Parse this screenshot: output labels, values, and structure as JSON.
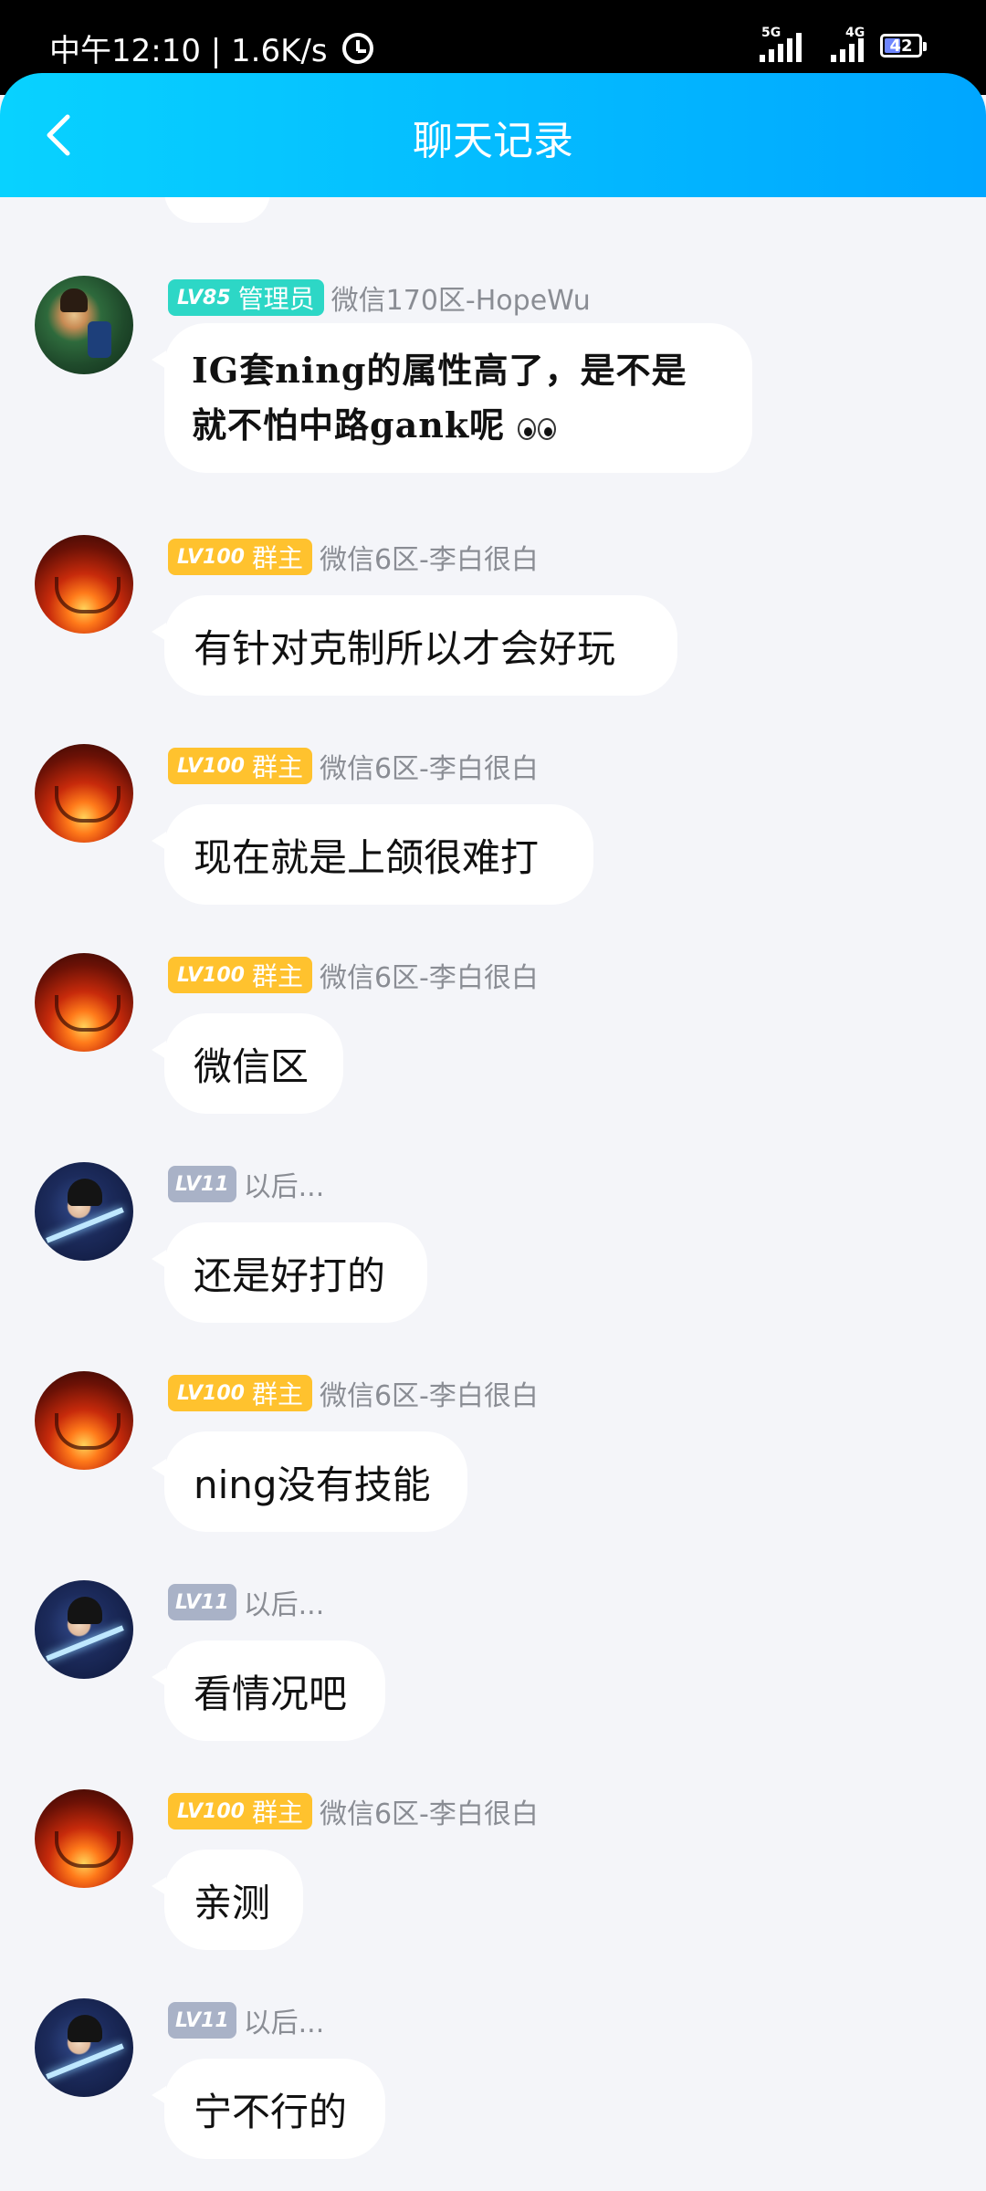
{
  "status_bar": {
    "time_speed": "中午12:10 | 1.6K/s",
    "network_1": "5G",
    "network_2": "4G",
    "battery": "42"
  },
  "header": {
    "title": "聊天记录"
  },
  "messages": [
    {
      "avatar": "green",
      "level": "LV85",
      "role": "管理员",
      "role_type": "admin",
      "sender": "微信170区-HopeWu",
      "text_lines": [
        "IG套ning的属性高了，是不是",
        "就不怕中路gank呢"
      ],
      "emoji": "eyes-emoji"
    },
    {
      "avatar": "fire",
      "level": "LV100",
      "role": "群主",
      "role_type": "owner",
      "sender": "微信6区-李白很白",
      "text": "有针对克制所以才会好玩"
    },
    {
      "avatar": "fire",
      "level": "LV100",
      "role": "群主",
      "role_type": "owner",
      "sender": "微信6区-李白很白",
      "text": "现在就是上颌很难打"
    },
    {
      "avatar": "fire",
      "level": "LV100",
      "role": "群主",
      "role_type": "owner",
      "sender": "微信6区-李白很白",
      "text": "微信区"
    },
    {
      "avatar": "anime",
      "level": "LV11",
      "role": "",
      "role_type": "member",
      "sender": "以后...",
      "text": "还是好打的"
    },
    {
      "avatar": "fire",
      "level": "LV100",
      "role": "群主",
      "role_type": "owner",
      "sender": "微信6区-李白很白",
      "text": "ning没有技能"
    },
    {
      "avatar": "anime",
      "level": "LV11",
      "role": "",
      "role_type": "member",
      "sender": "以后...",
      "text": "看情况吧"
    },
    {
      "avatar": "fire",
      "level": "LV100",
      "role": "群主",
      "role_type": "owner",
      "sender": "微信6区-李白很白",
      "text": "亲测"
    },
    {
      "avatar": "anime",
      "level": "LV11",
      "role": "",
      "role_type": "member",
      "sender": "以后...",
      "text": "宁不行的"
    }
  ],
  "colors": {
    "header_start": "#08d2ff",
    "header_end": "#00a6ff",
    "admin_badge": "#2dd7c6",
    "owner_badge": "#ffc22e",
    "member_badge": "#a9b2c7",
    "background": "#f4f5f9"
  }
}
